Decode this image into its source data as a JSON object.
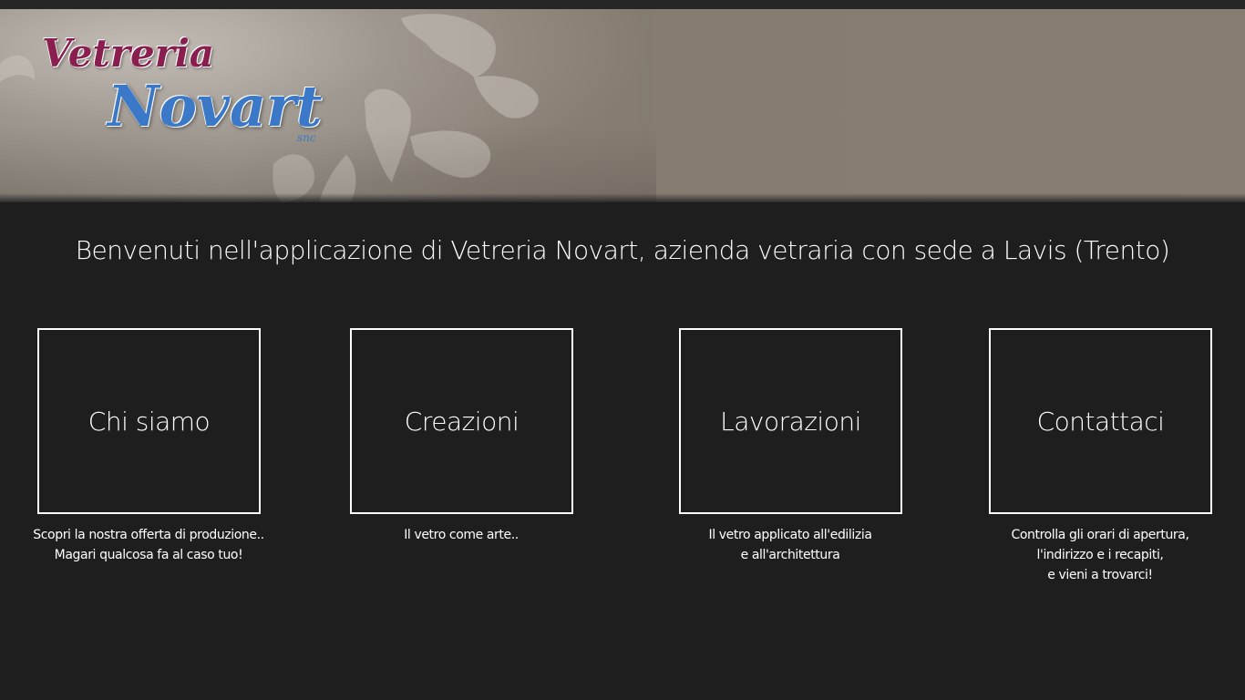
{
  "banner": {
    "logo_line1": "Vetreria",
    "logo_line2": "Novart",
    "logo_suffix": "snc",
    "logo_colors": {
      "line1": "#8a1f4f",
      "line2": "#3b78c8"
    }
  },
  "welcome": "Benvenuti nell'applicazione di Vetreria Novart, azienda vetraria con sede a Lavis (Trento)",
  "tiles": [
    {
      "label": "Chi siamo",
      "caption": [
        "Scopri la nostra offerta di produzione..",
        "Magari qualcosa fa al caso tuo!"
      ]
    },
    {
      "label": "Creazioni",
      "caption": [
        "Il vetro come arte.."
      ]
    },
    {
      "label": "Lavorazioni",
      "caption": [
        "Il vetro applicato all'edilizia",
        "e all'architettura"
      ]
    },
    {
      "label": "Contattaci",
      "caption": [
        "Controlla gli orari di apertura,",
        "l'indirizzo e i recapiti,",
        "e vieni a trovarci!"
      ]
    }
  ],
  "colors": {
    "background": "#1e1e1e",
    "tile_border": "#ffffff",
    "text": "#ffffff"
  }
}
